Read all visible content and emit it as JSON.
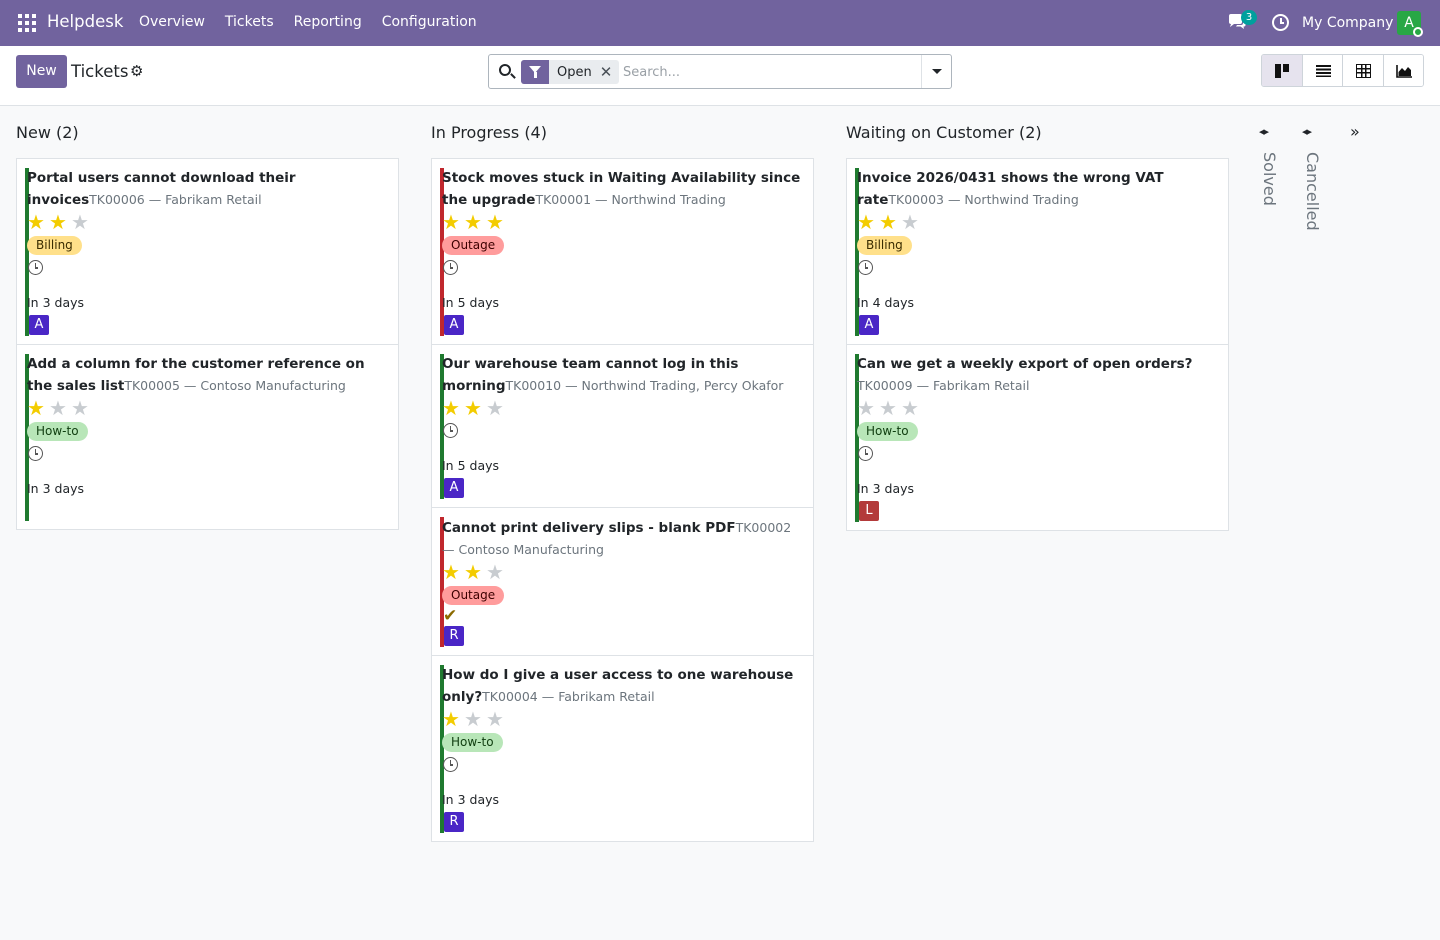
{
  "navbar": {
    "app_name": "Helpdesk",
    "menu": [
      "Overview",
      "Tickets",
      "Reporting",
      "Configuration"
    ],
    "chat_count": "3",
    "company": "My Company",
    "user_initial": "A"
  },
  "control": {
    "new_label": "New",
    "title": "Tickets",
    "filter_facet": "Open",
    "search_placeholder": "Search..."
  },
  "colors": {
    "brand": "#71639e",
    "priority_green": "#1f7a2f",
    "priority_red": "#c0272d",
    "avatar_blue": "#4a26c6",
    "avatar_red": "#b33a3a"
  },
  "columns": [
    {
      "header": "New (2)",
      "cards": [
        {
          "title": "Portal users cannot download their invoices",
          "ref": "TK00006 — Fabrikam Retail",
          "stars": 2,
          "tag": "Billing",
          "tag_class": "billing",
          "bar": "green",
          "activity": "clock",
          "deadline": "In 3 days",
          "assignee": "A",
          "avatar": "blue"
        },
        {
          "title": "Add a column for the customer reference on the sales list",
          "ref": "TK00005 — Contoso Manufacturing",
          "stars": 1,
          "tag": "How-to",
          "tag_class": "howto",
          "bar": "green",
          "activity": "clock",
          "deadline": "In 3 days",
          "assignee": "",
          "avatar": ""
        }
      ]
    },
    {
      "header": "In Progress (4)",
      "cards": [
        {
          "title": "Stock moves stuck in Waiting Availability since the upgrade",
          "ref": "TK00001 — Northwind Trading",
          "stars": 3,
          "tag": "Outage",
          "tag_class": "outage",
          "bar": "red",
          "activity": "clock",
          "deadline": "In 5 days",
          "assignee": "A",
          "avatar": "blue"
        },
        {
          "title": "Our warehouse team cannot log in this morning",
          "ref": "TK00010 — Northwind Trading, Percy Okafor",
          "stars": 2,
          "tag": "",
          "tag_class": "",
          "bar": "green",
          "activity": "clock",
          "deadline": "In 5 days",
          "assignee": "A",
          "avatar": "blue"
        },
        {
          "title": "Cannot print delivery slips - blank PDF",
          "ref": "TK00002 — Contoso Manufacturing",
          "stars": 2,
          "tag": "Outage",
          "tag_class": "outage",
          "bar": "red",
          "activity": "check",
          "deadline": "",
          "assignee": "R",
          "avatar": "blue"
        },
        {
          "title": "How do I give a user access to one warehouse only?",
          "ref": "TK00004 — Fabrikam Retail",
          "stars": 1,
          "tag": "How-to",
          "tag_class": "howto",
          "bar": "green",
          "activity": "clock",
          "deadline": "In 3 days",
          "assignee": "R",
          "avatar": "blue"
        }
      ]
    },
    {
      "header": "Waiting on Customer (2)",
      "cards": [
        {
          "title": "Invoice 2026/0431 shows the wrong VAT rate",
          "ref": "TK00003 — Northwind Trading",
          "stars": 2,
          "tag": "Billing",
          "tag_class": "billing",
          "bar": "green",
          "activity": "clock",
          "deadline": "In 4 days",
          "assignee": "A",
          "avatar": "blue"
        },
        {
          "title": "Can we get a weekly export of open orders?",
          "ref": "TK00009 — Fabrikam Retail",
          "stars": 0,
          "tag": "How-to",
          "tag_class": "howto",
          "bar": "green",
          "activity": "clock",
          "deadline": "In 3 days",
          "assignee": "L",
          "avatar": "red"
        }
      ]
    }
  ],
  "folded_columns": [
    "Solved",
    "Cancelled"
  ]
}
